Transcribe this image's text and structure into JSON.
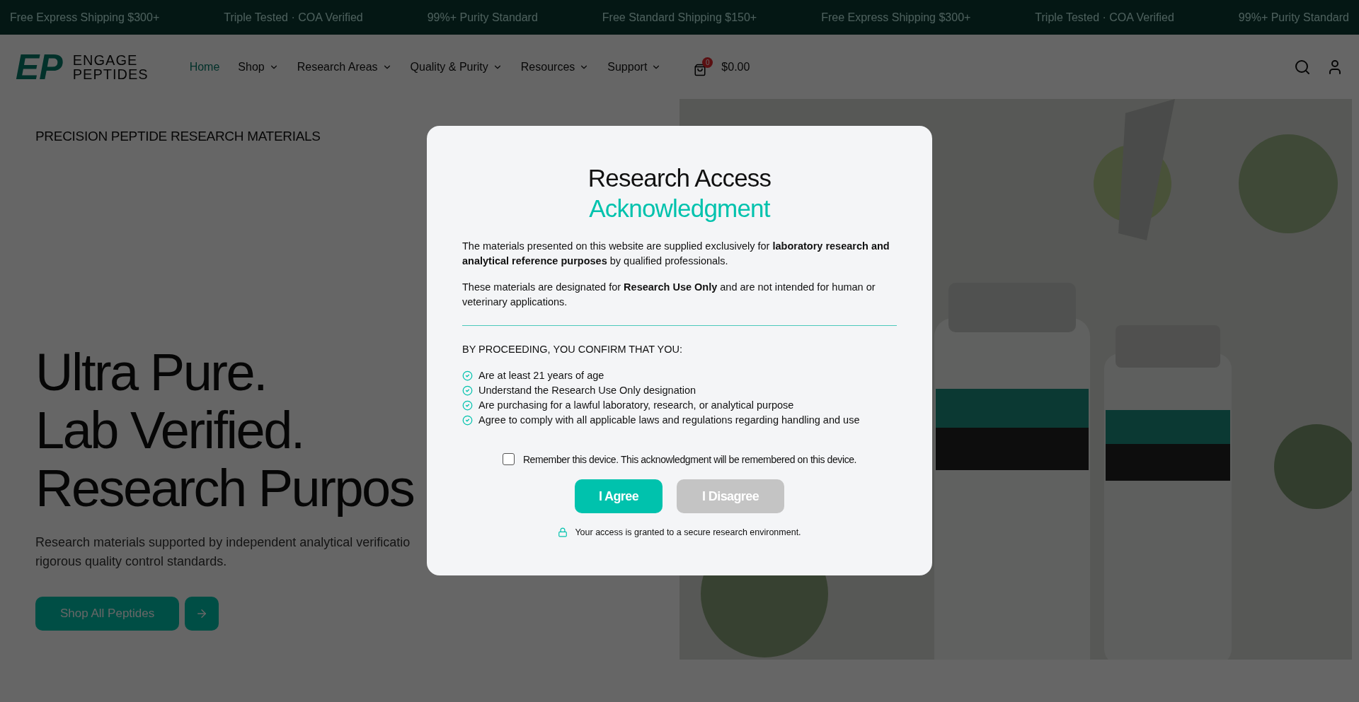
{
  "announcements": [
    "Free Express Shipping $300+",
    "Triple Tested · COA Verified",
    "99%+ Purity Standard",
    "Free Standard Shipping $150+",
    "Free Express Shipping $300+",
    "Triple Tested · COA Verified",
    "99%+ Purity Standard"
  ],
  "logo": {
    "mark": "EP",
    "line1": "ENGAGE",
    "line2": "PEPTIDES"
  },
  "nav": [
    {
      "label": "Home",
      "selected": true,
      "dropdown": false
    },
    {
      "label": "Shop",
      "selected": false,
      "dropdown": true
    },
    {
      "label": "Research Areas",
      "selected": false,
      "dropdown": true
    },
    {
      "label": "Quality & Purity",
      "selected": false,
      "dropdown": true
    },
    {
      "label": "Resources",
      "selected": false,
      "dropdown": true
    },
    {
      "label": "Support",
      "selected": false,
      "dropdown": true
    }
  ],
  "cart": {
    "count": "0",
    "total": "$0.00"
  },
  "hero": {
    "eyebrow": "PRECISION PEPTIDE RESEARCH MATERIALS",
    "heading": [
      "Ultra Pure.",
      "Lab Verified.",
      "Research Purpos"
    ],
    "text": [
      "Research materials supported by independent analytical verificatio",
      "rigorous quality control standards."
    ],
    "button": "Shop All Peptides",
    "image": {
      "kind": "picture"
    }
  },
  "modal": {
    "title": "Research Access",
    "accent": "Acknowledgment",
    "paragraphs": [
      "The materials presented on this website are supplied exclusively for **laboratory research and analytical reference purposes** by qualified professionals.",
      "These materials are designated for **Research Use Only** and are not intended for human or veterinary applications."
    ],
    "confirm_heading": "BY PROCEEDING, YOU CONFIRM THAT YOU:",
    "confirm_items": [
      "Are at least 21 years of age",
      "Understand the Research Use Only designation",
      "Are purchasing for a lawful laboratory, research, or analytical purpose",
      "Agree to comply with all applicable laws and regulations regarding handling and use"
    ],
    "remember": {
      "label": "Remember this device. This acknowledgment will be remembered on this device.",
      "checked": false
    },
    "buttons": [
      {
        "label": "I Agree",
        "kind": "primary"
      },
      {
        "label": "I Disagree",
        "kind": "secondary"
      }
    ],
    "footer": "Your access is granted to a secure research environment."
  }
}
